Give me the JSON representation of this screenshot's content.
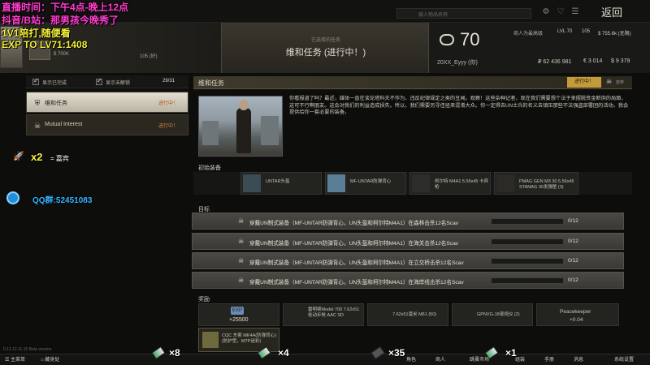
{
  "top": {
    "search_placeholder": "输入物品名称",
    "back_label": "返回"
  },
  "player": {
    "money": "$ 700K",
    "level_ratio": "105 (好)"
  },
  "quest_header": {
    "label": "已选择的任务",
    "title": "维和任务 (进行中！)"
  },
  "trader": {
    "level": "70",
    "name": "20XX_Eyyy (你)",
    "rank_label": "商人为最高级",
    "lvl": "LVL 70",
    "rep1": "105",
    "rep2": "$ 755.6k (无限)",
    "money_rub": "₽ 62 436 981",
    "money_eur": "€ 3 014",
    "money_usd": "$ 9 379"
  },
  "overlay": {
    "line1": "直播时间：下午4点-晚上12点",
    "line2": "抖音/B站：那男孩今晚秀了",
    "line3": "1V1陪打,随便看",
    "line4": "EXP TO LV71:1408",
    "gift_mult": "x2",
    "gift_eq": "= 嘉宾",
    "qq": "QQ群:52451083",
    "item_counts": [
      "×8",
      "×4",
      "×35",
      "×1"
    ]
  },
  "filters": {
    "show_completed": "显示已完成",
    "show_locked": "显示未解锁",
    "count": "29/31"
  },
  "quest_list": [
    {
      "title": "维和任务",
      "status": "进行中！"
    },
    {
      "title": "Mutual Interest",
      "status": "进行中！"
    }
  ],
  "detail": {
    "title": "维和任务",
    "status": "进行中！",
    "abandon": "放弃",
    "description": "你看报道了吗？最近，媒体一直在谈论塔科夫不作为、违反纪律规定之类的丑闻。观察！这些杂种记者，现在我们需要想个法子来摆脱资金断供的局面，这可不行啊朋友。这会对我们的利益造成损失。所以，我们需要另寻佳径来混淆大众。你一定得去UN士兵的名义去镇压那些不法强盗部署团的活动。我会提供给你一套必要的装备。",
    "start_label": "初始装备",
    "start_items": [
      "UNTAR头盔",
      "MF-UNTAR防弹背心",
      "柯尔特 M4A1 5.56x45 卡宾枪",
      "PMAG GEN M3 30 5.56x45 STANAG 30发弹匣 (3)"
    ],
    "objectives_label": "目标",
    "objectives": [
      {
        "text": "穿戴UN制式装备（MF-UNTAR防弹背心，UN头盔和柯尔特M4A1）在森林击杀12名Scav",
        "value": "0/12"
      },
      {
        "text": "穿戴UN制式装备（MF-UNTAR防弹背心，UN头盔和柯尔特M4A1）在海关击杀12名Scav",
        "value": "0/12"
      },
      {
        "text": "穿戴UN制式装备（MF-UNTAR防弹背心，UN头盔和柯尔特M4A1）在立交桥击杀12名Scav",
        "value": "0/12"
      },
      {
        "text": "穿戴UN制式装备（MF-UNTAR防弹背心，UN头盔和柯尔特M4A1）在海岸线击杀12名Scav",
        "value": "0/12"
      }
    ],
    "rewards_label": "奖励",
    "rewards": [
      {
        "label": "EXP",
        "value": "+25500"
      },
      {
        "label": "雷明顿Model 700 7.62x51 栓动步枪 AAC SD"
      },
      {
        "label": "7.62x51毫米 M61 (50)"
      },
      {
        "label": "GPNVG-18夜视仪 (2)"
      },
      {
        "label": "Peacekeeper",
        "value": "+0.04"
      },
      {
        "label": "CQC 东索 MK4A(防弹背心) (防护型，MTP迷彩)"
      }
    ]
  },
  "bottom": {
    "build": "0.12.12.11.15 Beta version",
    "main_menu": "主菜单",
    "hideout": "藏身处",
    "character": "角色",
    "traders": "商人",
    "flea": "跳蚤市场",
    "builds": "组装",
    "handbook": "手册",
    "messages": "消息",
    "settings": "系统设置"
  },
  "colors": {
    "accent": "#c39b3a",
    "in_progress": "#b34d1c",
    "overlay_pink": "#ff3fcf"
  }
}
